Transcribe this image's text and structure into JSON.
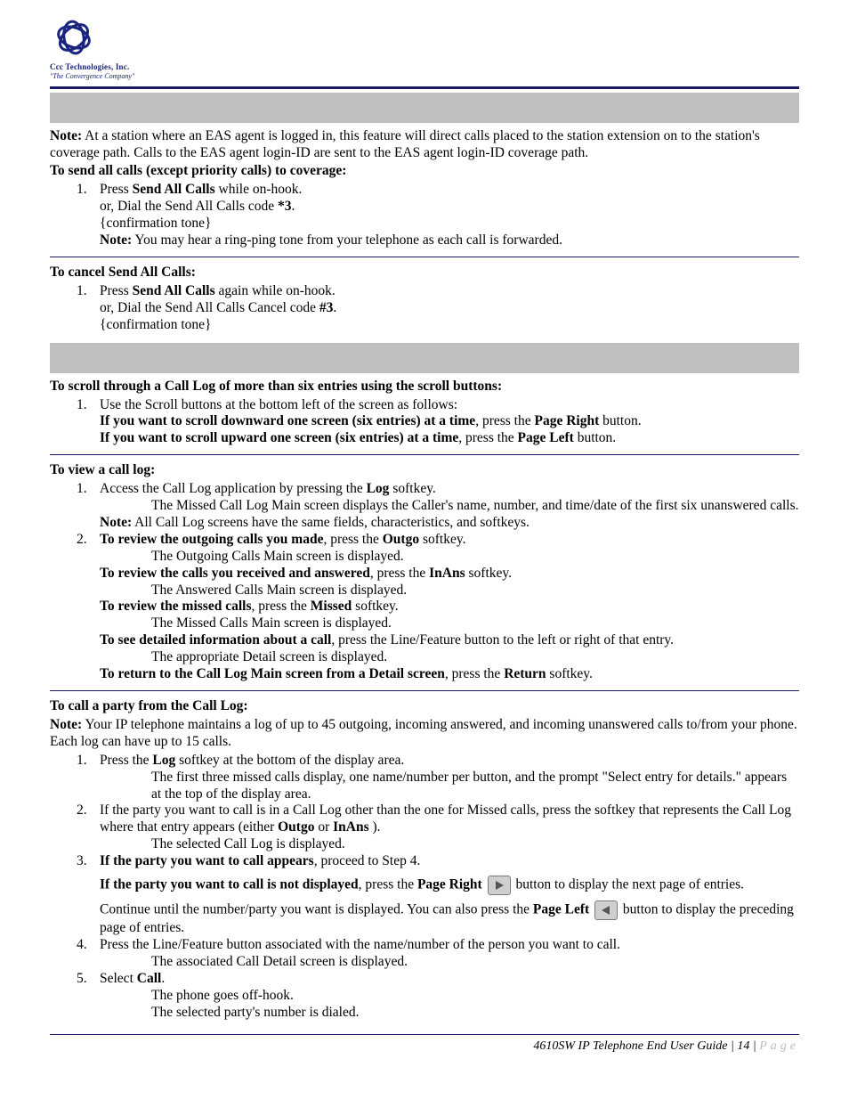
{
  "logo": {
    "line1": "Ccc Technologies, Inc.",
    "line2": "\"The Convergence Company\""
  },
  "note1": {
    "label": "Note:",
    "text": " At a station where an EAS agent is logged in, this feature will direct calls placed to the station extension on to the station's coverage path. Calls to the EAS agent login-ID are sent to the EAS agent login-ID coverage path."
  },
  "sendAll": {
    "head": "To send all calls (except priority calls) to coverage:",
    "s1a": "Press ",
    "s1b": "Send All Calls",
    "s1c": " while on-hook.",
    "s2a": "or, Dial the Send All Calls code ",
    "s2b": "*3",
    "s2c": ".",
    "s3": "{confirmation tone}",
    "noteLabel": "Note:",
    "noteText": " You may hear a ring-ping tone from your telephone as each call is forwarded."
  },
  "cancel": {
    "head": "To cancel Send All Calls:",
    "s1a": "Press ",
    "s1b": "Send All Calls",
    "s1c": " again while on-hook.",
    "s2a": "or, Dial the Send All Calls Cancel code ",
    "s2b": "#3",
    "s2c": ".",
    "s3": "{confirmation tone}"
  },
  "scroll": {
    "head": "To scroll through a Call Log of more than six entries using the scroll buttons:",
    "s1": "Use the Scroll buttons at the bottom left of the screen as follows:",
    "downBold": "If you want to scroll downward one screen (six entries) at a time",
    "downMid": ", press the ",
    "downBtn": "Page Right",
    "downEnd": " button.",
    "upBold": "If you want to scroll upward one screen (six entries) at a time",
    "upMid": ", press the ",
    "upBtn": "Page Left",
    "upEnd": " button."
  },
  "view": {
    "head": "To view a call log:",
    "s1a": "Access the Call Log application by pressing the ",
    "s1b": "Log",
    "s1c": " softkey.",
    "s1sub": "The Missed Call Log Main screen displays the Caller's name, number, and time/date of the first six unanswered calls.",
    "noteLabel": "Note:",
    "noteText": " All Call Log screens have the same fields, characteristics, and softkeys.",
    "s2aBold": "To review the outgoing calls you made",
    "s2aMid": ", press the ",
    "s2aBtn": "Outgo",
    "s2aEnd": " softkey.",
    "s2aSub": "The Outgoing Calls Main screen is displayed.",
    "s2bBold": "To review the calls you received and answered",
    "s2bMid": ", press the ",
    "s2bBtn": "InAns",
    "s2bEnd": " softkey.",
    "s2bSub": "The Answered Calls Main screen is displayed.",
    "s2cBold": "To review the missed calls",
    "s2cMid": ", press the ",
    "s2cBtn": "Missed",
    "s2cEnd": " softkey.",
    "s2cSub": "The Missed Calls Main screen is displayed.",
    "s2dBold": "To see detailed information about a call",
    "s2dEnd": ", press the Line/Feature button to the left or right of that entry.",
    "s2dSub": "The appropriate Detail screen is displayed.",
    "s2eBold": "To return to the Call Log Main screen from a Detail screen",
    "s2eMid": ", press the ",
    "s2eBtn": "Return",
    "s2eEnd": " softkey."
  },
  "callParty": {
    "head": "To call a party from the Call Log:",
    "noteLabel": "Note:",
    "noteText": " Your IP telephone maintains a log of up to 45 outgoing, incoming answered, and incoming unanswered calls to/from your phone. Each log can have up to 15 calls.",
    "s1a": "Press the ",
    "s1b": "Log",
    "s1c": " softkey at the bottom of the display area.",
    "s1sub": "The first three missed calls display, one name/number per button, and the prompt \"Select entry for details.\" appears at the top of the display area.",
    "s2a": "If the party you want to call is in a Call Log other than the one for Missed calls, press the softkey that represents the Call Log where that entry appears (either ",
    "s2b": "Outgo",
    "s2c": " or ",
    "s2d": "InAns",
    "s2e": " ).",
    "s2sub": "The selected Call Log is displayed.",
    "s3aBold": "If the party you want to call appears",
    "s3aEnd": ", proceed to Step 4.",
    "s3bBold": "If the party you want to call is not displayed",
    "s3bMid": ", press the ",
    "s3bBtn": "Page Right",
    "s3bEnd": " button to display the next page of entries.",
    "s3cText": "Continue until the number/party you want is displayed. You can also press the ",
    "s3cBtn": "Page Left",
    "s3cEnd": " button to display the preceding page of entries.",
    "s4": "Press the Line/Feature button associated with the name/number of the person you want to call.",
    "s4sub": "The associated Call Detail screen is displayed.",
    "s5a": "Select ",
    "s5b": "Call",
    "s5c": ".",
    "s5sub1": "The phone goes off-hook.",
    "s5sub2": "The selected party's number is dialed."
  },
  "footer": {
    "title": "4610SW IP Telephone End User Guide",
    "sep1": " | ",
    "pageNum": "14",
    "sep2": " | ",
    "pageWord": "Page"
  }
}
